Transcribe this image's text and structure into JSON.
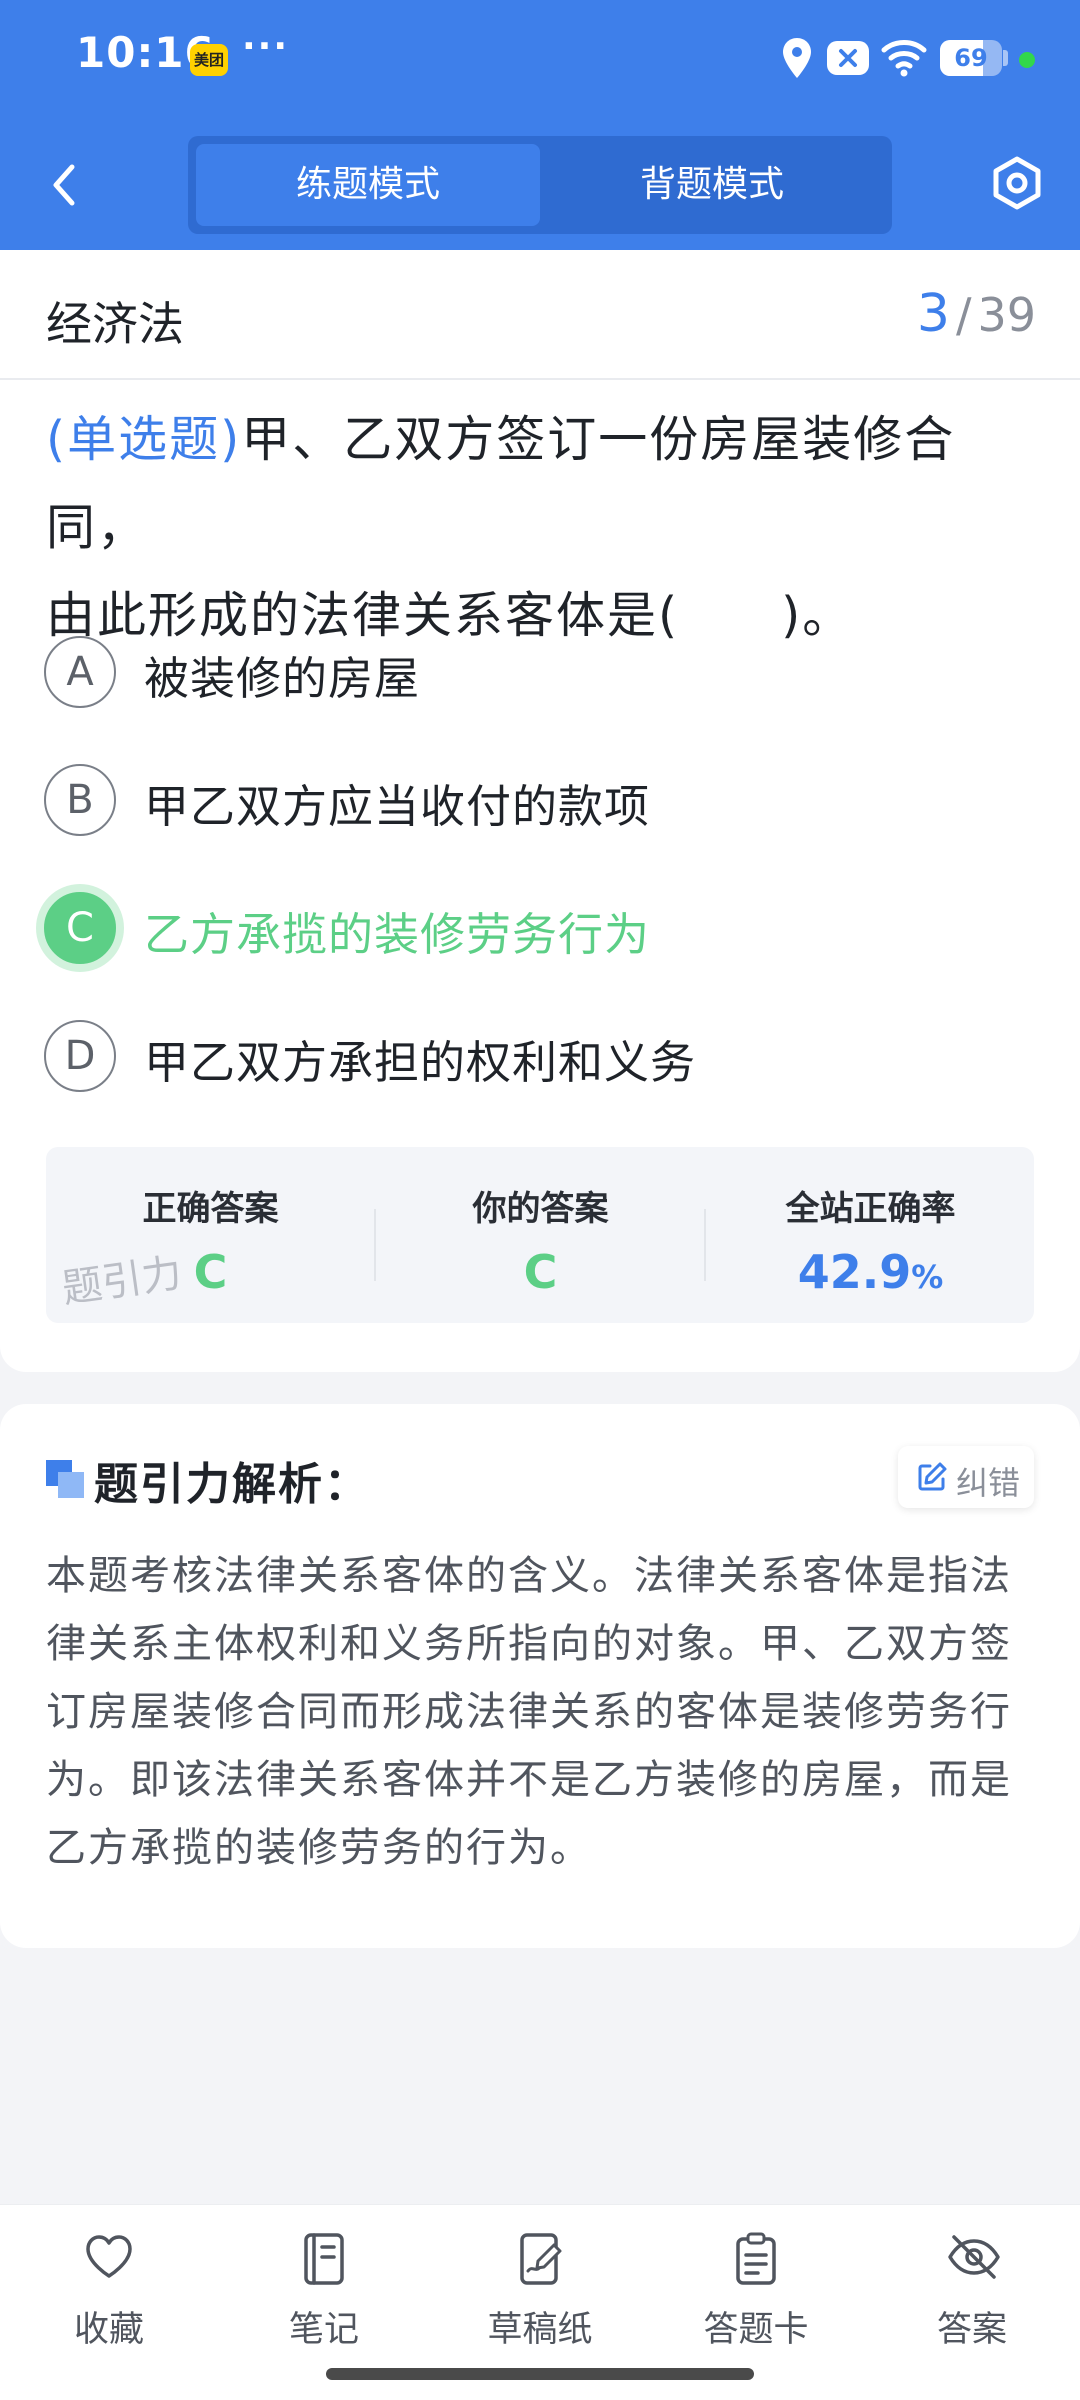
{
  "status_bar": {
    "time": "10:16",
    "app_badge": "美团",
    "more_dots": "···",
    "battery_level": 69,
    "battery_text": "69"
  },
  "header": {
    "modes": [
      "练题模式",
      "背题模式"
    ],
    "active_mode": "练题模式"
  },
  "question": {
    "subject": "经济法",
    "current": "3",
    "separator": "/",
    "total": "39",
    "type_label": "(单选题)",
    "stem_line1": "甲、乙双方签订一份房屋装修合同，",
    "stem_line2": "由此形成的法律关系客体是(　　)。",
    "options": [
      {
        "letter": "A",
        "text": "被装修的房屋"
      },
      {
        "letter": "B",
        "text": "甲乙双方应当收付的款项"
      },
      {
        "letter": "C",
        "text": "乙方承揽的装修劳务行为"
      },
      {
        "letter": "D",
        "text": "甲乙双方承担的权利和义务"
      }
    ],
    "selected": "C"
  },
  "answer_summary": {
    "correct_label": "正确答案",
    "correct_value": "C",
    "yours_label": "你的答案",
    "yours_value": "C",
    "rate_label": "全站正确率",
    "rate_value": "42.9",
    "rate_unit": "%",
    "watermark": "题引力"
  },
  "analysis": {
    "title": "题引力解析：",
    "correct_button": "纠错",
    "lines": [
      "本题考核法律关系客体的含义。法律关系客体是指法",
      "律关系主体权利和义务所指向的对象。甲、乙双方签",
      "订房屋装修合同而形成法律关系的客体是装修劳务行",
      "为。即该法律关系客体并不是乙方装修的房屋，而是",
      "乙方承揽的装修劳务的行为。"
    ]
  },
  "bottom_nav": {
    "items": [
      {
        "label": "收藏",
        "icon": "heart-icon"
      },
      {
        "label": "笔记",
        "icon": "notebook-icon"
      },
      {
        "label": "草稿纸",
        "icon": "draft-paper-icon"
      },
      {
        "label": "答题卡",
        "icon": "answer-card-icon"
      },
      {
        "label": "答案",
        "icon": "eye-off-icon"
      }
    ]
  },
  "colors": {
    "primary": "#3e7fea",
    "correct_green": "#5ccf86",
    "page_bg": "#f3f4f7"
  }
}
